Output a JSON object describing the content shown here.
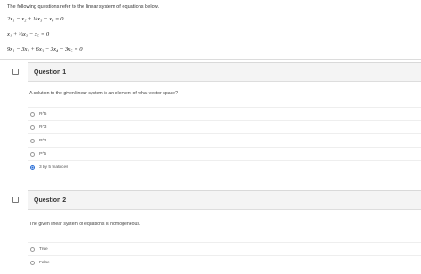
{
  "intro": "The following questions refer to the linear system of equations below.",
  "equations": [
    "2x₁ − x₂ + ⅓x₃ − x₄   = 0",
    "x₁          + ⅔x₃          − x₅ = 0",
    "9x₁ − 3x₂ + 6x₃ − 3x₄ − 3x₅ = 0"
  ],
  "questions": [
    {
      "title": "Question 1",
      "text": "A solution to the given linear system is an element of what vector space?",
      "options": [
        "R^5",
        "R^3",
        "P^3",
        "P^5",
        "3 by 5 matrices"
      ],
      "selected_index": 4
    },
    {
      "title": "Question 2",
      "text": "The given linear system of equations is homogeneous.",
      "options": [
        "True",
        "False"
      ],
      "selected_index": null
    }
  ],
  "colors": {
    "accent": "#2b6fd6",
    "header_bg": "#f4f4f4",
    "border": "#dddddd"
  }
}
